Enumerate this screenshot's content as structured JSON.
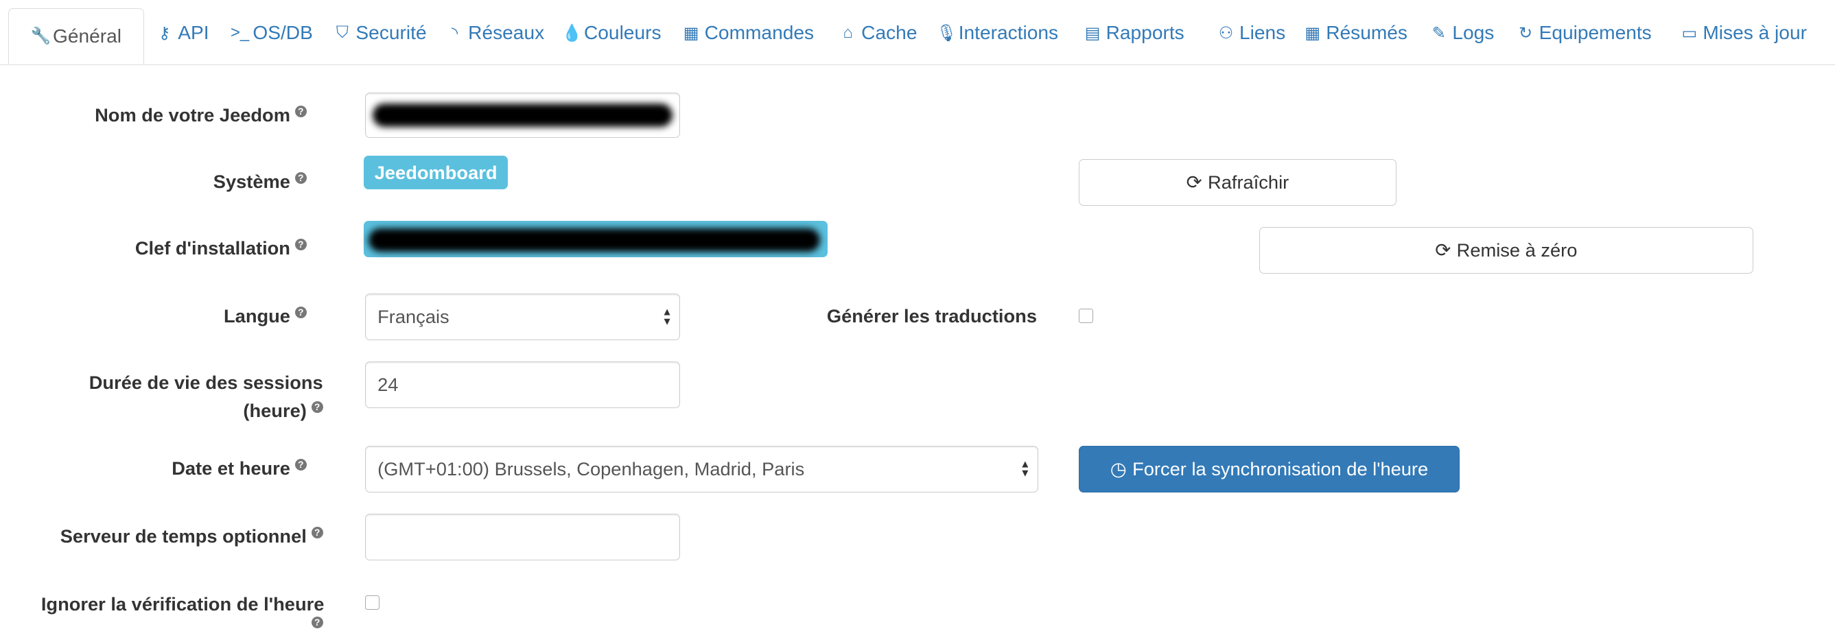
{
  "tabs": [
    {
      "label": "Général",
      "icon": "wrench-icon",
      "glyph": "🔧"
    },
    {
      "label": "API",
      "icon": "key-icon",
      "glyph": "⚷"
    },
    {
      "label": "OS/DB",
      "icon": "terminal-icon",
      "glyph": ">_"
    },
    {
      "label": "Securité",
      "icon": "shield-icon",
      "glyph": "⛉"
    },
    {
      "label": "Réseaux",
      "icon": "rss-icon",
      "glyph": "◝"
    },
    {
      "label": "Couleurs",
      "icon": "tint-icon",
      "glyph": "💧"
    },
    {
      "label": "Commandes",
      "icon": "table-icon",
      "glyph": "▦"
    },
    {
      "label": "Cache",
      "icon": "hdd-icon",
      "glyph": "⌂"
    },
    {
      "label": "Interactions",
      "icon": "microphone-icon",
      "glyph": "🎙"
    },
    {
      "label": "Rapports",
      "icon": "newspaper-icon",
      "glyph": "▤"
    },
    {
      "label": "Liens",
      "icon": "sitemap-icon",
      "glyph": "⚇"
    },
    {
      "label": "Résumés",
      "icon": "grid-icon",
      "glyph": "▦"
    },
    {
      "label": "Logs",
      "icon": "edit-icon",
      "glyph": "✎"
    },
    {
      "label": "Equipements",
      "icon": "history-24h-icon",
      "glyph": "↻"
    },
    {
      "label": "Mises à jour",
      "icon": "credit-card-icon",
      "glyph": "▭"
    }
  ],
  "form": {
    "name_label": "Nom de votre Jeedom",
    "system_label": "Système",
    "system_value": "Jeedomboard",
    "refresh_button": "Rafraîchir",
    "key_label": "Clef d'installation",
    "reset_button": "Remise à zéro",
    "language_label": "Langue",
    "language_value": "Français",
    "translations_label": "Générer les traductions",
    "translations_checked": false,
    "session_label_1": "Durée de vie des sessions",
    "session_label_2": "(heure)",
    "session_value": "24",
    "datetime_label": "Date et heure",
    "timezone_value": "(GMT+01:00) Brussels, Copenhagen, Madrid, Paris",
    "sync_button": "Forcer la synchronisation de l'heure",
    "timeserver_label": "Serveur de temps optionnel",
    "timeserver_value": "",
    "ignore_time_label": "Ignorer la vérification de l'heure",
    "ignore_time_checked": false,
    "help_glyph": "?",
    "refresh_glyph": "⟳",
    "clock_glyph": "◷"
  },
  "colors": {
    "link": "#337ab7",
    "badge": "#5bc0de",
    "primary": "#337ab7"
  }
}
